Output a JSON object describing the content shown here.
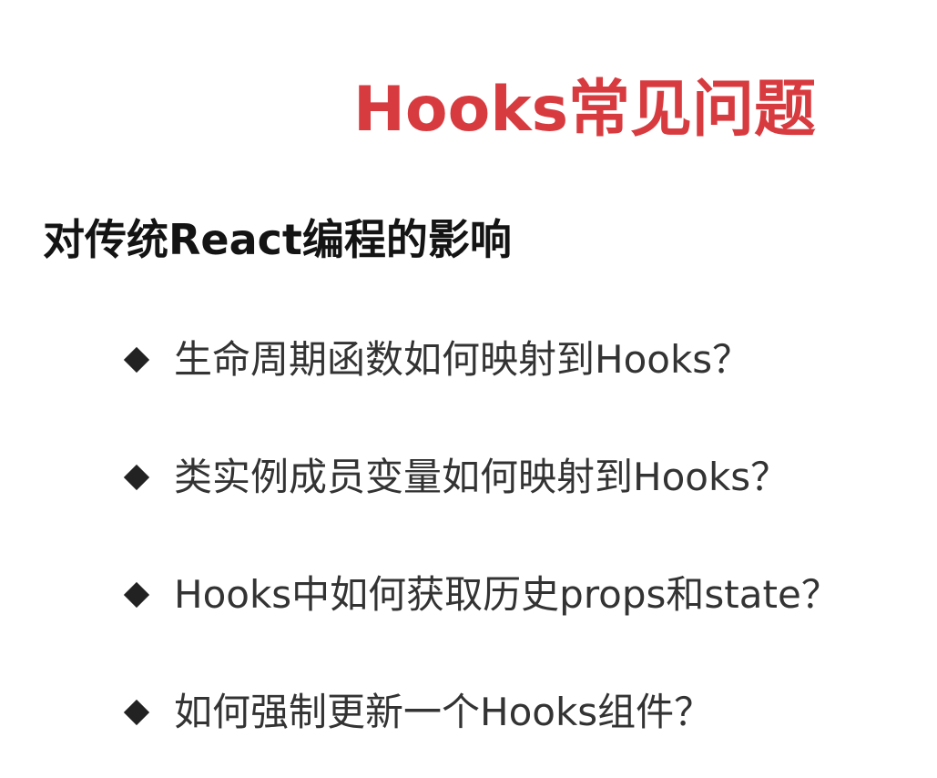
{
  "slide": {
    "title": "Hooks常见问题",
    "subtitle": "对传统React编程的影响",
    "bullets": [
      {
        "icon": "diamond-bullet-icon",
        "text": "生命周期函数如何映射到Hooks？"
      },
      {
        "icon": "diamond-bullet-icon",
        "text": "类实例成员变量如何映射到Hooks？"
      },
      {
        "icon": "diamond-bullet-icon",
        "text": "Hooks中如何获取历史props和state？"
      },
      {
        "icon": "diamond-bullet-icon",
        "text": "如何强制更新一个Hooks组件？"
      }
    ]
  },
  "colors": {
    "title": "#d83b3f",
    "subtitle": "#141414",
    "bullet_text": "#333333",
    "background": "#ffffff"
  }
}
